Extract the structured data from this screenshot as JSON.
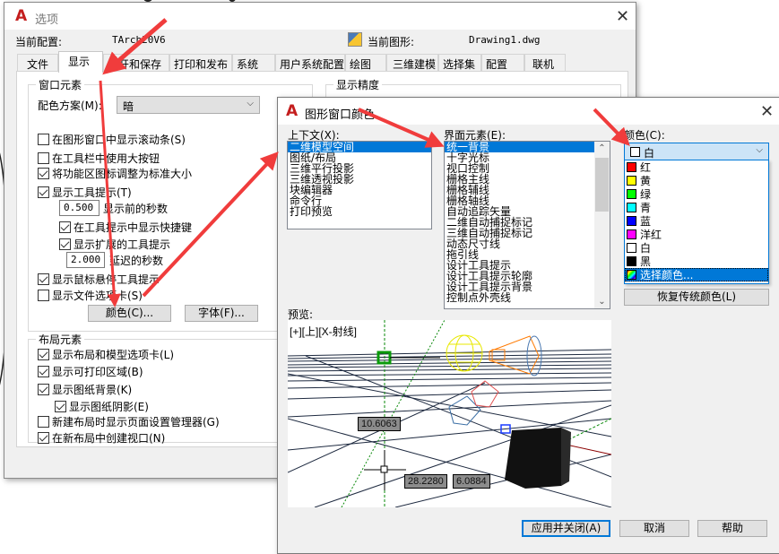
{
  "options_dialog": {
    "title": "选项",
    "current_profile_label": "当前配置:",
    "current_profile_value": "TArch20V6",
    "current_drawing_label": "当前图形:",
    "current_drawing_value": "Drawing1.dwg",
    "tabs": [
      "文件",
      "显示",
      "打开和保存",
      "打印和发布",
      "系统",
      "用户系统配置",
      "绘图",
      "三维建模",
      "选择集",
      "配置",
      "联机"
    ],
    "active_tab": "显示",
    "window_elements": {
      "title": "窗口元素",
      "color_scheme_label": "配色方案(M):",
      "color_scheme_value": "暗",
      "checkboxes": [
        {
          "label": "在图形窗口中显示滚动条(S)",
          "checked": false
        },
        {
          "label": "在工具栏中使用大按钮",
          "checked": false
        },
        {
          "label": "将功能区图标调整为标准大小",
          "checked": true
        },
        {
          "label": "显示工具提示(T)",
          "checked": true
        }
      ],
      "tooltip_delay_value": "0.500",
      "tooltip_delay_label": "显示前的秒数",
      "sub_checkboxes": [
        {
          "label": "在工具提示中显示快捷键",
          "checked": true
        },
        {
          "label": "显示扩展的工具提示",
          "checked": true
        }
      ],
      "extended_delay_value": "2.000",
      "extended_delay_label": "延迟的秒数",
      "checkboxes2": [
        {
          "label": "显示鼠标悬停工具提示",
          "checked": true
        },
        {
          "label": "显示文件选项卡(S)",
          "checked": false
        }
      ],
      "colors_button": "颜色(C)...",
      "fonts_button": "字体(F)..."
    },
    "display_resolution_title": "显示精度",
    "layout_elements": {
      "title": "布局元素",
      "checkboxes": [
        {
          "label": "显示布局和模型选项卡(L)",
          "checked": true
        },
        {
          "label": "显示可打印区域(B)",
          "checked": true
        },
        {
          "label": "显示图纸背景(K)",
          "checked": true
        },
        {
          "label": "显示图纸阴影(E)",
          "checked": true,
          "indent": true
        },
        {
          "label": "新建布局时显示页面设置管理器(G)",
          "checked": false
        },
        {
          "label": "在新布局中创建视口(N)",
          "checked": true
        }
      ]
    }
  },
  "color_dialog": {
    "title": "图形窗口颜色",
    "context_label": "上下文(X):",
    "context_items": [
      "二维模型空间",
      "图纸/布局",
      "三维平行投影",
      "三维透视投影",
      "块编辑器",
      "命令行",
      "打印预览"
    ],
    "context_selected": 0,
    "interface_label": "界面元素(E):",
    "interface_items": [
      "统一背景",
      "十字光标",
      "视口控制",
      "栅格主线",
      "栅格辅线",
      "栅格轴线",
      "自动追踪矢量",
      "二维自动捕捉标记",
      "三维自动捕捉标记",
      "动态尺寸线",
      "拖引线",
      "设计工具提示",
      "设计工具提示轮廓",
      "设计工具提示背景",
      "控制点外壳线"
    ],
    "interface_selected": 0,
    "color_label": "颜色(C):",
    "color_value": "白",
    "color_options": [
      {
        "name": "红",
        "hex": "#ff0000"
      },
      {
        "name": "黄",
        "hex": "#ffff00"
      },
      {
        "name": "绿",
        "hex": "#00ff00"
      },
      {
        "name": "青",
        "hex": "#00ffff"
      },
      {
        "name": "蓝",
        "hex": "#0000ff"
      },
      {
        "name": "洋红",
        "hex": "#ff00ff"
      },
      {
        "name": "白",
        "hex": "#ffffff"
      },
      {
        "name": "黑",
        "hex": "#000000"
      },
      {
        "name": "选择颜色...",
        "hex": "multicolor",
        "selected": true
      }
    ],
    "restore_button": "恢复传统颜色(L)",
    "preview_label": "预览:",
    "viewport_label": "[+][上][X-射线]",
    "dim_values": [
      "10.6063",
      "28.2280",
      "6.0884"
    ],
    "apply_close_button": "应用并关闭(A)",
    "cancel_button": "取消",
    "help_button": "帮助"
  },
  "annotation_color": "#f03c3c"
}
